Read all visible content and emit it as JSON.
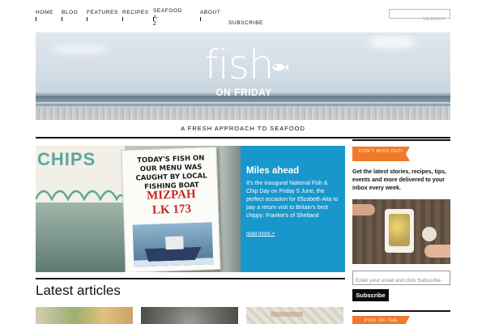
{
  "nav": {
    "items": [
      {
        "label": "HOME"
      },
      {
        "label": "BLOG"
      },
      {
        "label": "FEATURES"
      },
      {
        "label": "RECIPES"
      },
      {
        "label_line1": "SEAFOOD A-",
        "label_line2": "Z"
      },
      {
        "label": "ABOUT"
      },
      {
        "label": "SUBSCRIBE"
      }
    ]
  },
  "search": {
    "placeholder": "SEARCH"
  },
  "hero": {
    "logo_main": "fish",
    "logo_sub": "ON FRIDAY",
    "tagline": "A FRESH APPROACH TO SEAFOOD"
  },
  "feature": {
    "photo": {
      "chips_sign": "CHIPS",
      "board_text": "TODAY'S FISH ON OUR MENU WAS CAUGHT BY LOCAL FISHING BOAT",
      "boat_name": "MIZPAH",
      "boat_reg": "LK 173"
    },
    "title": "Miles ahead",
    "body": "It's the inaugural National Fish & Chip Day on Friday 5 June, the perfect occasion for Elizabeth Aita to pay a return visit to Britain's best chippy: Frankie's of Shetland",
    "link": "read more >"
  },
  "sidebar": {
    "badge_1": "DON'T MISS OUT!",
    "signup_copy": "Get the latest stories, recipes, tips, events and more delivered to your inbox every week.",
    "email_placeholder": "Enter your email and click Subscribe",
    "subscribe_button": "Subscribe",
    "badge_2": "PICK OF THE"
  },
  "latest": {
    "title": "Latest articles"
  },
  "colors": {
    "accent_orange": "#ef7b29",
    "feature_blue": "#1897cc",
    "text": "#111111"
  }
}
